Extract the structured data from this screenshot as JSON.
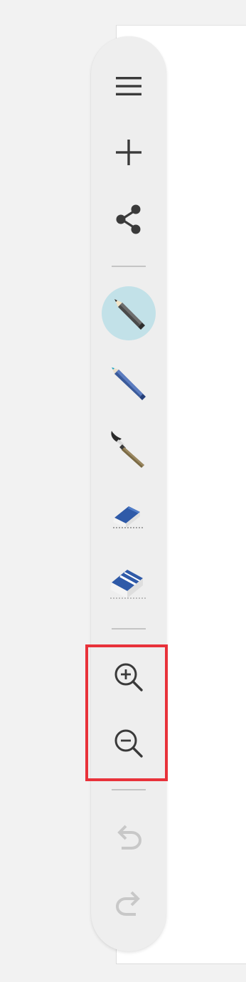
{
  "toolbar": {
    "groups": [
      {
        "tools": [
          {
            "name": "menu",
            "icon": "menu-icon",
            "interactable": true
          },
          {
            "name": "new",
            "icon": "plus-icon",
            "interactable": true
          },
          {
            "name": "share",
            "icon": "share-icon",
            "interactable": true
          }
        ]
      },
      {
        "tools": [
          {
            "name": "pencil",
            "icon": "pencil-icon",
            "active": true
          },
          {
            "name": "pen",
            "icon": "pen-icon"
          },
          {
            "name": "brush",
            "icon": "brush-icon"
          },
          {
            "name": "eraser-small",
            "icon": "eraser-small-icon"
          },
          {
            "name": "eraser-large",
            "icon": "eraser-large-icon"
          }
        ]
      },
      {
        "tools": [
          {
            "name": "zoom-in",
            "icon": "zoom-in-icon"
          },
          {
            "name": "zoom-out",
            "icon": "zoom-out-icon"
          }
        ]
      },
      {
        "tools": [
          {
            "name": "undo",
            "icon": "undo-icon",
            "disabled": true
          },
          {
            "name": "redo",
            "icon": "redo-icon",
            "disabled": true
          }
        ]
      }
    ]
  },
  "colors": {
    "toolbar_background": "#eeeeee",
    "active_tool_background": "#c2e1e8",
    "icon_color": "#3a3a3a",
    "disabled_icon_color": "#c8c8c8",
    "highlight_border": "#e8323a"
  }
}
